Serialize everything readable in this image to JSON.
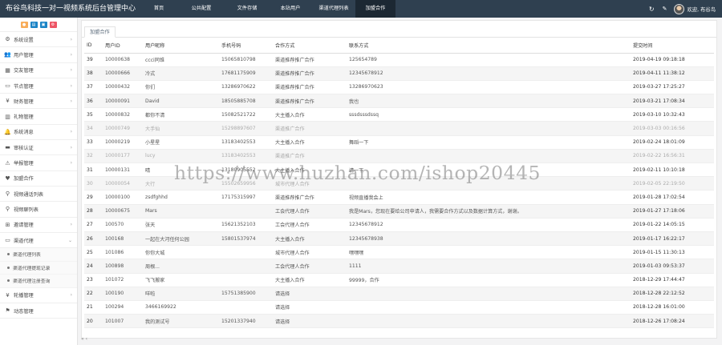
{
  "header": {
    "title": "布谷鸟科技一对一视频系统后台管理中心",
    "nav": [
      {
        "label": "首页",
        "w": 46
      },
      {
        "label": "公共配置",
        "w": 60
      },
      {
        "label": "文件存储",
        "w": 54
      },
      {
        "label": "本站用户",
        "w": 54
      },
      {
        "label": "渠道代理列表",
        "w": 54
      },
      {
        "label": "加盟合作",
        "w": 50,
        "active": true
      }
    ],
    "welcome": "欢迎, 布谷鸟",
    "refresh_icon": "refresh-icon",
    "settings_icon": "wrench-icon"
  },
  "quick_buttons": [
    {
      "name": "quick-button-1",
      "color": "#f8ac59",
      "icon": "●"
    },
    {
      "name": "quick-button-2",
      "color": "#1c84c6",
      "icon": "▤"
    },
    {
      "name": "quick-button-3",
      "color": "#1c84c6",
      "icon": "▣"
    },
    {
      "name": "quick-button-4",
      "color": "#ed5565",
      "icon": "⚙"
    }
  ],
  "sidebar": {
    "items": [
      {
        "label": "系统设置",
        "icon": "⚙",
        "name": "gear-icon",
        "arrow": "›"
      },
      {
        "label": "用户管理",
        "icon": "👥",
        "name": "users-icon",
        "arrow": "›"
      },
      {
        "label": "交友管理",
        "icon": "▦",
        "name": "grid-icon",
        "arrow": "›"
      },
      {
        "label": "节点管理",
        "icon": "▭",
        "name": "monitor-icon",
        "arrow": "›"
      },
      {
        "label": "财务管理",
        "icon": "¥",
        "name": "yen-icon",
        "arrow": "›"
      },
      {
        "label": "礼物管理",
        "icon": "▥",
        "name": "gift-icon",
        "arrow": ""
      },
      {
        "label": "系统消息",
        "icon": "🔔",
        "name": "bell-icon",
        "arrow": "›"
      },
      {
        "label": "审核认证",
        "icon": "▬",
        "name": "card-icon",
        "arrow": "›"
      },
      {
        "label": "举报管理",
        "icon": "⚠",
        "name": "warning-icon",
        "arrow": "›"
      },
      {
        "label": "加盟合作",
        "icon": "♥",
        "name": "heart-icon",
        "arrow": ""
      },
      {
        "label": "视频通话列表",
        "icon": "⚲",
        "name": "search-icon",
        "arrow": ""
      },
      {
        "label": "视频聊列表",
        "icon": "⚲",
        "name": "search-icon",
        "arrow": ""
      },
      {
        "label": "邀请管理",
        "icon": "⊞",
        "name": "invite-icon",
        "arrow": "›"
      },
      {
        "label": "渠道代理",
        "icon": "▭",
        "name": "monitor-icon",
        "arrow": "⌄"
      }
    ],
    "subitems": [
      "渠道代理列表",
      "渠道代理提现记录",
      "渠道代理注册查询"
    ],
    "bottom": [
      {
        "label": "轮播管理",
        "icon": "¥",
        "name": "yen-icon",
        "arrow": "›"
      },
      {
        "label": "动态管理",
        "icon": "⚑",
        "name": "flag-icon",
        "arrow": ""
      }
    ]
  },
  "tab": {
    "label": "加盟合作"
  },
  "table": {
    "columns": [
      "ID",
      "用户ID",
      "用户昵称",
      "手机号码",
      "合作方式",
      "联系方式",
      "提交时间"
    ],
    "rows": [
      [
        "39",
        "10000638",
        "ccci同维",
        "15065810798",
        "渠道推荐推广合作",
        "125654789",
        "2019-04-19 09:18:18"
      ],
      [
        "38",
        "10000666",
        "冷式",
        "17681175909",
        "渠道推荐推广合作",
        "12345678912",
        "2019-04-11 11:38:12"
      ],
      [
        "37",
        "10000432",
        "你们",
        "13286970622",
        "渠道推荐推广合作",
        "13286970623",
        "2019-03-27 17:25:27"
      ],
      [
        "36",
        "10000091",
        "David",
        "18505885708",
        "渠道推荐推广合作",
        "我也",
        "2019-03-21 17:08:34"
      ],
      [
        "35",
        "10000832",
        "都你不清",
        "15082521722",
        "大主播入合作",
        "sssdsssdssq",
        "2019-03-10 10:32:43"
      ],
      [
        "34",
        "10000749",
        "大手仙",
        "15298897607",
        "渠道推广合作",
        "",
        "2019-03-03 00:16:56"
      ],
      [
        "33",
        "10000219",
        "小星星",
        "13183402553",
        "大主播入合作",
        "舞蹈一下",
        "2019-02-24 18:01:09"
      ],
      [
        "32",
        "10000177",
        "lucy",
        "13183402553",
        "渠道推广合作",
        "",
        "2019-02-22 16:56:31"
      ],
      [
        "31",
        "10000131",
        "晴",
        "13180905552",
        "大主播入合作",
        "请一下",
        "2019-02-11 10:10:18"
      ],
      [
        "30",
        "10000054",
        "大行",
        "15502659956",
        "城市代理人合作",
        "",
        "2019-02-05 22:19:50"
      ],
      [
        "29",
        "10000100",
        "zsdfghhd",
        "17175315997",
        "渠道推荐推广合作",
        "视频直播我会上",
        "2019-01-28 17:02:54"
      ],
      [
        "28",
        "10000675",
        "Mars",
        "",
        "工会代理人合作",
        "我是Mars，您现在要给公司申请人，我需要合作方式以及数据计算方式，谢谢。",
        "2019-01-27 17:18:06"
      ],
      [
        "27",
        "100570",
        "张天",
        "15621352103",
        "工会代理人合作",
        "12345678912",
        "2019-01-22 14:05:15"
      ],
      [
        "26",
        "100168",
        "一起在大河任何公园",
        "15801537974",
        "大主播入合作",
        "12345678938",
        "2019-01-17 16:22:17"
      ],
      [
        "25",
        "101086",
        "你你大城",
        "",
        "城市代理人合作",
        "嘿嘿嘿",
        "2019-01-15 11:30:13"
      ],
      [
        "24",
        "100898",
        "周根...",
        "",
        "工会代理人合作",
        "1111",
        "2019-01-03 09:53:37"
      ],
      [
        "23",
        "101072",
        "飞飞搬家",
        "",
        "大主播入合作",
        "99999，合作",
        "2018-12-29 17:44:47"
      ],
      [
        "22",
        "100190",
        "咩啦",
        "15751385900",
        "请选择",
        "",
        "2018-12-28 22:12:52"
      ],
      [
        "21",
        "100294",
        "3466169922",
        "",
        "请选择",
        "",
        "2018-12-28 16:01:00"
      ],
      [
        "20",
        "101007",
        "我的测试号",
        "15201337940",
        "请选择",
        "",
        "2018-12-26 17:08:24"
      ]
    ],
    "faded_rows": [
      5,
      7,
      9
    ]
  },
  "watermark": "https://www.huzhan.com/ishop20445",
  "footer": "«  ‹"
}
